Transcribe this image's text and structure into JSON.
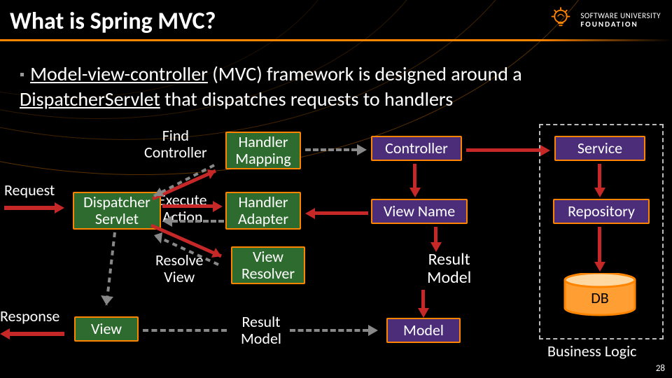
{
  "title": "What is Spring MVC?",
  "logo": {
    "line1": "SOFTWARE UNIVERSITY",
    "line2": "FOUNDATION"
  },
  "bullet": {
    "pre": "Model-view-controller",
    "mid1": " (MVC) framework is designed around a ",
    "u2": "DispatcherServlet",
    "post": " that dispatches requests to handlers"
  },
  "labels": {
    "request": "Request",
    "response": "Response",
    "find_controller": "Find\nController",
    "execute_action": "Execute\nAction",
    "resolve_view": "Resolve\nView",
    "result_model_small": "Result\nModel",
    "result_model_big": "Result\nModel",
    "business_logic": "Business Logic"
  },
  "boxes": {
    "dispatcher_servlet": "Dispatcher\nServlet",
    "handler_mapping": "Handler\nMapping",
    "handler_adapter": "Handler\nAdapter",
    "view_resolver": "View\nResolver",
    "view": "View",
    "controller": "Controller",
    "view_name": "View Name",
    "model": "Model",
    "service": "Service",
    "repository": "Repository",
    "db": "DB"
  },
  "page": "28"
}
